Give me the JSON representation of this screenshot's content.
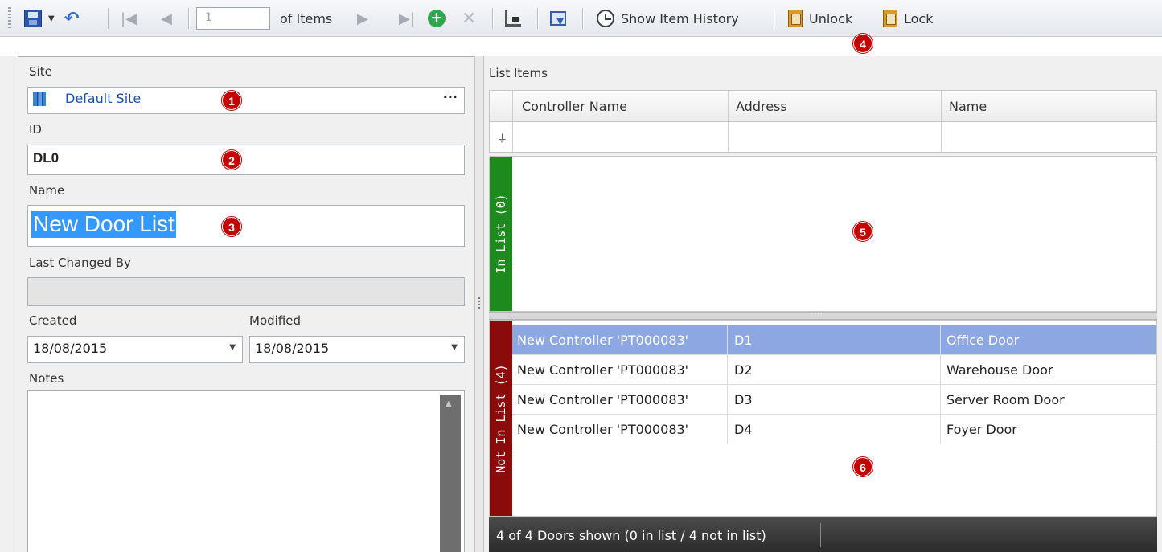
{
  "toolbar": {
    "pager_value": "1",
    "of_items": "of Items",
    "show_history": "Show Item History",
    "unlock": "Unlock",
    "lock": "Lock"
  },
  "form": {
    "site_label": "Site",
    "site_value": "Default Site",
    "site_browse": "···",
    "id_label": "ID",
    "id_value": "DL0",
    "name_label": "Name",
    "name_value": "New Door List",
    "last_changed_label": "Last Changed By",
    "last_changed_value": "",
    "created_label": "Created",
    "created_value": "18/08/2015",
    "modified_label": "Modified",
    "modified_value": "18/08/2015",
    "notes_label": "Notes"
  },
  "list": {
    "title": "List Items",
    "columns": [
      "Controller Name",
      "Address",
      "Name"
    ],
    "in_list_label": "In List (0)",
    "not_in_list_label": "Not In List (4)",
    "rows": [
      {
        "controller": "New Controller 'PT000083'",
        "address": "D1",
        "name": "Office Door"
      },
      {
        "controller": "New Controller 'PT000083'",
        "address": "D2",
        "name": "Warehouse Door"
      },
      {
        "controller": "New Controller 'PT000083'",
        "address": "D3",
        "name": "Server Room Door"
      },
      {
        "controller": "New Controller 'PT000083'",
        "address": "D4",
        "name": "Foyer Door"
      }
    ],
    "status": "4 of 4 Doors shown (0 in list / 4 not in list)"
  },
  "callouts": [
    "1",
    "2",
    "3",
    "4",
    "5",
    "6"
  ],
  "colors": {
    "in_list_tab": "#1e8a1e",
    "not_in_list_tab": "#8b0a0a",
    "selected_row": "#8da7e2",
    "callout": "#c40000"
  }
}
